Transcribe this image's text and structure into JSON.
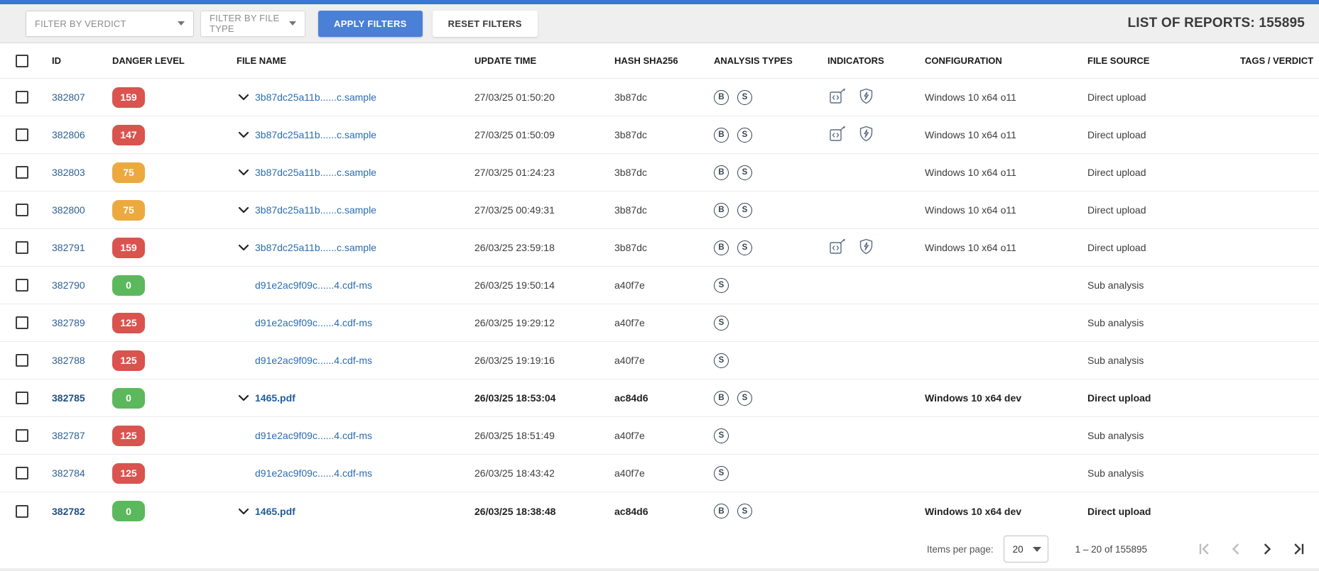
{
  "toolbar": {
    "verdict_filter_placeholder": "FILTER BY VERDICT",
    "filetype_filter_placeholder": "FILTER BY FILE TYPE",
    "apply_label": "APPLY FILTERS",
    "reset_label": "RESET FILTERS",
    "reports_count_label": "LIST OF REPORTS: 155895"
  },
  "colors": {
    "accent_blue": "#4a80d6",
    "top_strip_blue": "#3a76d2",
    "danger": {
      "red": "#d9534f",
      "orange": "#eca93f",
      "green": "#5cb85c"
    },
    "link_blue": "#2a6db0",
    "indicator_icon": "#5b6b85"
  },
  "icons": {
    "analysis_b": "circled-letter-B",
    "analysis_s": "circled-letter-S",
    "code-injection": "code-box-with-pencil",
    "shield-evasion": "shield-with-lightning",
    "expand": "chevron-down",
    "pagination_first": "bar-chevron-left",
    "pagination_prev": "chevron-left",
    "pagination_next": "chevron-right",
    "pagination_last": "chevron-right-bar"
  },
  "table": {
    "columns": [
      "ID",
      "DANGER LEVEL",
      "FILE NAME",
      "UPDATE TIME",
      "HASH SHA256",
      "ANALYSIS TYPES",
      "INDICATORS",
      "CONFIGURATION",
      "FILE SOURCE",
      "TAGS / VERDICT"
    ],
    "rows": [
      {
        "id": "382807",
        "danger_level": "159",
        "danger_color": "red",
        "expandable": true,
        "file_name": "3b87dc25a11b......c.sample",
        "update_time": "27/03/25 01:50:20",
        "hash_sha256": "3b87dc",
        "analysis_types": [
          "B",
          "S"
        ],
        "indicators": [
          "code-injection",
          "shield-evasion"
        ],
        "configuration": "Windows 10 x64 o11",
        "file_source": "Direct upload",
        "tags": "",
        "bold": false
      },
      {
        "id": "382806",
        "danger_level": "147",
        "danger_color": "red",
        "expandable": true,
        "file_name": "3b87dc25a11b......c.sample",
        "update_time": "27/03/25 01:50:09",
        "hash_sha256": "3b87dc",
        "analysis_types": [
          "B",
          "S"
        ],
        "indicators": [
          "code-injection",
          "shield-evasion"
        ],
        "configuration": "Windows 10 x64 o11",
        "file_source": "Direct upload",
        "tags": "",
        "bold": false
      },
      {
        "id": "382803",
        "danger_level": "75",
        "danger_color": "orange",
        "expandable": true,
        "file_name": "3b87dc25a11b......c.sample",
        "update_time": "27/03/25 01:24:23",
        "hash_sha256": "3b87dc",
        "analysis_types": [
          "B",
          "S"
        ],
        "indicators": [],
        "configuration": "Windows 10 x64 o11",
        "file_source": "Direct upload",
        "tags": "",
        "bold": false
      },
      {
        "id": "382800",
        "danger_level": "75",
        "danger_color": "orange",
        "expandable": true,
        "file_name": "3b87dc25a11b......c.sample",
        "update_time": "27/03/25 00:49:31",
        "hash_sha256": "3b87dc",
        "analysis_types": [
          "B",
          "S"
        ],
        "indicators": [],
        "configuration": "Windows 10 x64 o11",
        "file_source": "Direct upload",
        "tags": "",
        "bold": false
      },
      {
        "id": "382791",
        "danger_level": "159",
        "danger_color": "red",
        "expandable": true,
        "file_name": "3b87dc25a11b......c.sample",
        "update_time": "26/03/25 23:59:18",
        "hash_sha256": "3b87dc",
        "analysis_types": [
          "B",
          "S"
        ],
        "indicators": [
          "code-injection",
          "shield-evasion"
        ],
        "configuration": "Windows 10 x64 o11",
        "file_source": "Direct upload",
        "tags": "",
        "bold": false
      },
      {
        "id": "382790",
        "danger_level": "0",
        "danger_color": "green",
        "expandable": false,
        "file_name": "d91e2ac9f09c......4.cdf-ms",
        "update_time": "26/03/25 19:50:14",
        "hash_sha256": "a40f7e",
        "analysis_types": [
          "S"
        ],
        "indicators": [],
        "configuration": "",
        "file_source": "Sub analysis",
        "tags": "",
        "bold": false
      },
      {
        "id": "382789",
        "danger_level": "125",
        "danger_color": "red",
        "expandable": false,
        "file_name": "d91e2ac9f09c......4.cdf-ms",
        "update_time": "26/03/25 19:29:12",
        "hash_sha256": "a40f7e",
        "analysis_types": [
          "S"
        ],
        "indicators": [],
        "configuration": "",
        "file_source": "Sub analysis",
        "tags": "",
        "bold": false
      },
      {
        "id": "382788",
        "danger_level": "125",
        "danger_color": "red",
        "expandable": false,
        "file_name": "d91e2ac9f09c......4.cdf-ms",
        "update_time": "26/03/25 19:19:16",
        "hash_sha256": "a40f7e",
        "analysis_types": [
          "S"
        ],
        "indicators": [],
        "configuration": "",
        "file_source": "Sub analysis",
        "tags": "",
        "bold": false
      },
      {
        "id": "382785",
        "danger_level": "0",
        "danger_color": "green",
        "expandable": true,
        "file_name": "1465.pdf",
        "update_time": "26/03/25 18:53:04",
        "hash_sha256": "ac84d6",
        "analysis_types": [
          "B",
          "S"
        ],
        "indicators": [],
        "configuration": "Windows 10 x64 dev",
        "file_source": "Direct upload",
        "tags": "",
        "bold": true
      },
      {
        "id": "382787",
        "danger_level": "125",
        "danger_color": "red",
        "expandable": false,
        "file_name": "d91e2ac9f09c......4.cdf-ms",
        "update_time": "26/03/25 18:51:49",
        "hash_sha256": "a40f7e",
        "analysis_types": [
          "S"
        ],
        "indicators": [],
        "configuration": "",
        "file_source": "Sub analysis",
        "tags": "",
        "bold": false
      },
      {
        "id": "382784",
        "danger_level": "125",
        "danger_color": "red",
        "expandable": false,
        "file_name": "d91e2ac9f09c......4.cdf-ms",
        "update_time": "26/03/25 18:43:42",
        "hash_sha256": "a40f7e",
        "analysis_types": [
          "S"
        ],
        "indicators": [],
        "configuration": "",
        "file_source": "Sub analysis",
        "tags": "",
        "bold": false
      },
      {
        "id": "382782",
        "danger_level": "0",
        "danger_color": "green",
        "expandable": true,
        "file_name": "1465.pdf",
        "update_time": "26/03/25 18:38:48",
        "hash_sha256": "ac84d6",
        "analysis_types": [
          "B",
          "S"
        ],
        "indicators": [],
        "configuration": "Windows 10 x64 dev",
        "file_source": "Direct upload",
        "tags": "",
        "bold": true
      }
    ]
  },
  "pagination": {
    "items_per_page_label": "Items per page:",
    "items_per_page_value": "20",
    "range_label": "1 – 20 of 155895"
  }
}
